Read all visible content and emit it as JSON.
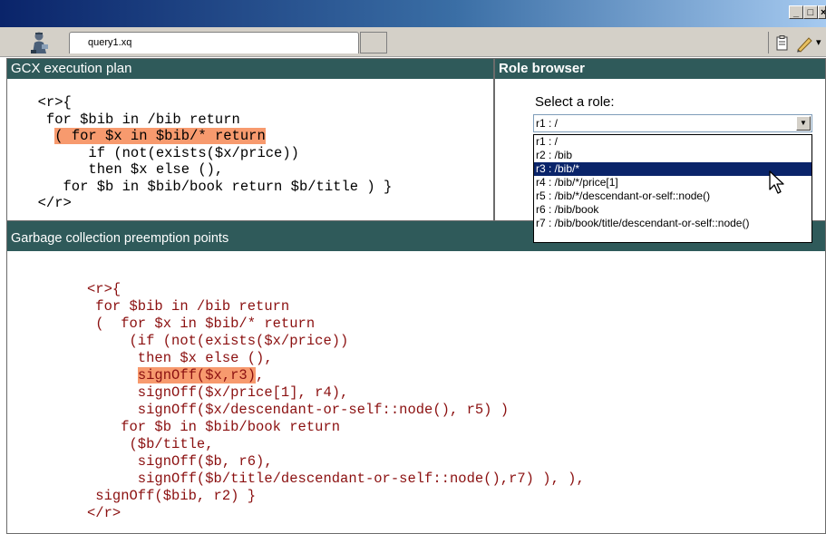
{
  "window": {
    "buttons": [
      "_",
      "□",
      "×"
    ]
  },
  "toolbar": {
    "tab_label": "query1.xq",
    "app_icon": "user-icon",
    "clipboard_icon": "clipboard-icon",
    "pencil_icon": "pencil-icon",
    "menu_arrow": "▾"
  },
  "plan_panel": {
    "title": "GCX execution plan",
    "lines": [
      "  <r>{",
      "   for $bib in /bib return",
      "",
      "        if (not(exists($x/price))",
      "        then $x else (),",
      "     for $b in $bib/book return $b/title ) }",
      "  </r>"
    ],
    "highlight_text": "( for $x in $bib/* return"
  },
  "role_panel": {
    "title": "Role browser",
    "select_label": "Select a role:",
    "selected_value": "r1 : /",
    "options": [
      "r1 : /",
      "r2 : /bib",
      "r3 : /bib/*",
      "r4 : /bib/*/price[1]",
      "r5 : /bib/*/descendant-or-self::node()",
      "r6 : /bib/book",
      "r7 : /bib/book/title/descendant-or-self::node()"
    ],
    "highlighted_option": 2,
    "cursor_icon": "mouse-pointer-icon"
  },
  "gc_panel": {
    "title": "Garbage collection preemption points",
    "lines": [
      "<r>{",
      " for $bib in /bib return",
      " (  for $x in $bib/* return",
      "     (if (not(exists($x/price))",
      "      then $x else (),",
      "",
      "      signOff($x/price[1], r4),",
      "      signOff($x/descendant-or-self::node(), r5) )",
      "    for $b in $bib/book return",
      "     ($b/title,",
      "      signOff($b, r6),",
      "      signOff($b/title/descendant-or-self::node(),r7) ), ),",
      " signOff($bib, r2) }",
      "</r>"
    ],
    "highlight_text": "signOff($x,r3)",
    "highlight_suffix": ","
  }
}
